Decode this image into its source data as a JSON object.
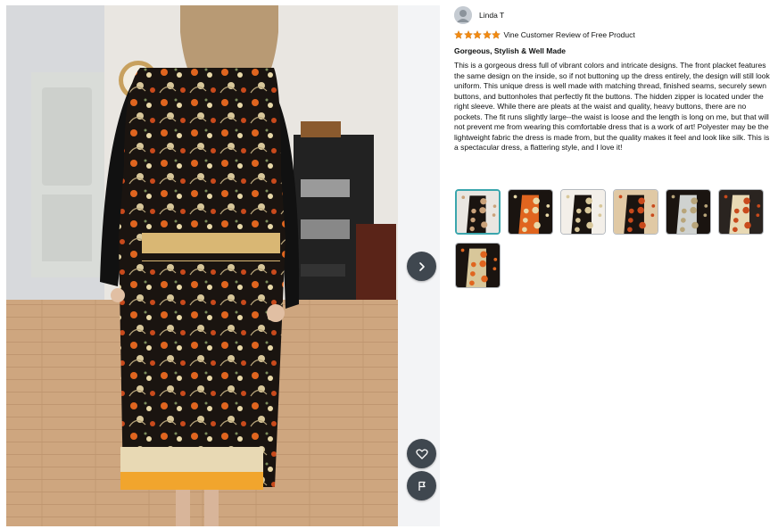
{
  "colors": {
    "star": "#f38a10",
    "nav_button": "#3f474f",
    "selected_thumb_border": "#3aa6ad"
  },
  "photo": {
    "next_icon": "chevron-right-icon",
    "like_icon": "heart-icon",
    "report_icon": "flag-icon"
  },
  "review": {
    "author": "Linda T",
    "rating": 5,
    "rating_max": 5,
    "vine_label": "Vine Customer Review of Free Product",
    "title": "Gorgeous, Stylish & Well Made",
    "body": "This is a gorgeous dress full of vibrant colors and intricate designs. The front placket features the same design on the inside, so if not buttoning up the dress entirely, the design will still look uniform. This unique dress is well made with matching thread, finished seams, securely sewn buttons, and buttonholes that perfectly fit the buttons. The hidden zipper is located under the right sleeve. While there are pleats at the waist and quality, heavy buttons, there are no pockets. The fit runs slightly large--the waist is loose and the length is long on me, but that will not prevent me from wearing this comfortable dress that is a work of art! Polyester may be the lightweight fabric the dress is made from, but the quality makes it feel and look like silk. This is a spectacular dress, a flattering style, and I love it!"
  },
  "thumbnails": {
    "count": 7,
    "selected_index": 0
  }
}
